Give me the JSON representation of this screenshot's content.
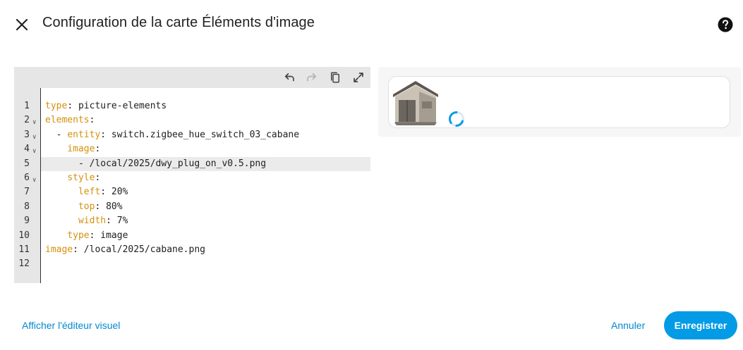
{
  "dialog": {
    "title": "Configuration de la carte Éléments d'image"
  },
  "icons": {
    "close": "close-icon",
    "help": "help-circle-icon",
    "undo": "undo-icon",
    "redo": "redo-icon",
    "copy": "copy-icon",
    "fullscreen": "fullscreen-icon"
  },
  "editor": {
    "lines": [
      {
        "n": "1",
        "fold": false,
        "indent": "",
        "key": "type",
        "value": " picture-elements"
      },
      {
        "n": "2",
        "fold": true,
        "indent": "",
        "key": "elements",
        "value": ""
      },
      {
        "n": "3",
        "fold": true,
        "indent": "  - ",
        "key": "entity",
        "value": " switch.zigbee_hue_switch_03_cabane"
      },
      {
        "n": "4",
        "fold": true,
        "indent": "    ",
        "key": "image",
        "value": ""
      },
      {
        "n": "5",
        "fold": false,
        "indent": "",
        "key": "",
        "value": "      - /local/2025/dwy_plug_on_v0.5.png"
      },
      {
        "n": "6",
        "fold": true,
        "indent": "    ",
        "key": "style",
        "value": ""
      },
      {
        "n": "7",
        "fold": false,
        "indent": "      ",
        "key": "left",
        "value": " 20%"
      },
      {
        "n": "8",
        "fold": false,
        "indent": "      ",
        "key": "top",
        "value": " 80%"
      },
      {
        "n": "9",
        "fold": false,
        "indent": "      ",
        "key": "width",
        "value": " 7%"
      },
      {
        "n": "10",
        "fold": false,
        "indent": "    ",
        "key": "type",
        "value": " image"
      },
      {
        "n": "11",
        "fold": false,
        "indent": "",
        "key": "image",
        "value": " /local/2025/cabane.png"
      },
      {
        "n": "12",
        "fold": false,
        "indent": "",
        "key": "",
        "value": ""
      }
    ]
  },
  "footer": {
    "visual_editor": "Afficher l'éditeur visuel",
    "cancel": "Annuler",
    "save": "Enregistrer"
  },
  "colors": {
    "accent": "#039be5",
    "link": "#0288d1",
    "yaml_key": "#d4910c"
  }
}
